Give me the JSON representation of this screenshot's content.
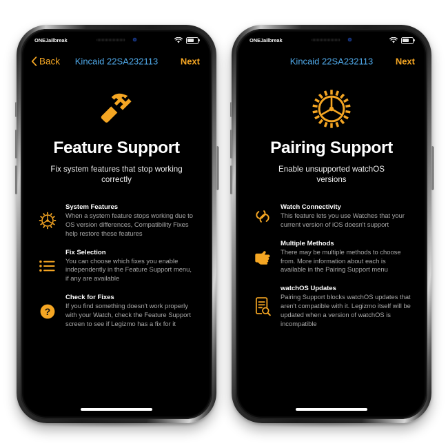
{
  "accent_color": "#F5A623",
  "title_link_color": "#4FA8E8",
  "screen_background": "#000000",
  "phones": [
    {
      "status_bar": {
        "carrier": "ONEJailbreak",
        "wifi_icon": "wifi-icon",
        "battery_icon": "battery-icon"
      },
      "nav": {
        "back_label": "Back",
        "back_icon": "chevron-left-icon",
        "title": "Kincaid 22SA232113",
        "next_label": "Next"
      },
      "hero_icon": "hammer-icon",
      "page_title": "Feature Support",
      "page_subtitle": "Fix system features that stop working correctly",
      "features": [
        {
          "icon": "gear-icon",
          "title": "System Features",
          "desc": "When a system feature stops working due to OS version differences, Compatibility Fixes help restore these features"
        },
        {
          "icon": "list-bullet-icon",
          "title": "Fix Selection",
          "desc": "You can choose which fixes you enable independently in the Feature Support menu, if any are available"
        },
        {
          "icon": "question-circle-icon",
          "title": "Check for Fixes",
          "desc": "If you find something doesn't work properly with your Watch, check the Feature Support screen to see if Legizmo has a fix for it"
        }
      ]
    },
    {
      "status_bar": {
        "carrier": "ONEJailbreak",
        "wifi_icon": "wifi-icon",
        "battery_icon": "battery-icon"
      },
      "nav": {
        "back_label": "",
        "back_icon": "",
        "title": "Kincaid 22SA232113",
        "next_label": "Next"
      },
      "hero_icon": "gear-large-icon",
      "page_title": "Pairing Support",
      "page_subtitle": "Enable unsupported watchOS versions",
      "features": [
        {
          "icon": "link-chain-icon",
          "title": "Watch Connectivity",
          "desc": "This feature lets you use Watches that your current version of iOS doesn't support"
        },
        {
          "icon": "pointing-hand-icon",
          "title": "Multiple Methods",
          "desc": "There may be multiple methods to choose from. More information about each is available in the Pairing Support menu"
        },
        {
          "icon": "document-search-icon",
          "title": "watchOS Updates",
          "desc": "Pairing Support blocks watchOS updates that aren't compatible with it. Legizmo itself will be updated when a version of watchOS is incompatible"
        }
      ]
    }
  ]
}
